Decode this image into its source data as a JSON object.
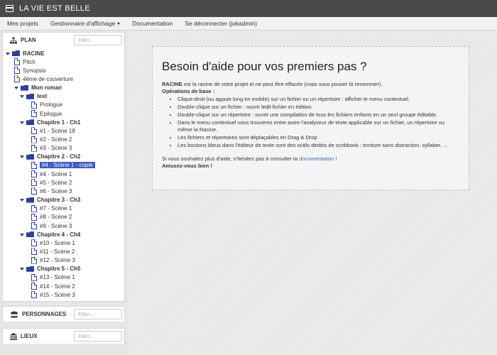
{
  "app": {
    "title": "LA VIE EST BELLE"
  },
  "menu": {
    "projects": "Mes projets",
    "display_manager": "Gestionnaire d'affichage",
    "documentation": "Documentation",
    "logout": "Se déconnecter (jokadmin)"
  },
  "panels": {
    "plan": {
      "label": "PLAN",
      "filter_placeholder": "Filter..."
    },
    "characters": {
      "label": "PERSONNAGES",
      "filter_placeholder": "Filter..."
    },
    "places": {
      "label": "LIEUX",
      "filter_placeholder": "Filter..."
    }
  },
  "tree": [
    {
      "label": "RACINE",
      "kind": "folder",
      "level": 0,
      "bold": true
    },
    {
      "label": "Pitch",
      "kind": "file",
      "level": 1
    },
    {
      "label": "Synopsis",
      "kind": "file",
      "level": 1
    },
    {
      "label": "4ème de couverture",
      "kind": "file",
      "level": 1
    },
    {
      "label": "Mon roman",
      "kind": "folder",
      "level": 1,
      "bold": true
    },
    {
      "label": "test",
      "kind": "folder",
      "level": 2,
      "bold": true
    },
    {
      "label": "Prologue",
      "kind": "file",
      "level": 3
    },
    {
      "label": "Epilogue",
      "kind": "file",
      "level": 3
    },
    {
      "label": "Chapitre 1 - Ch1",
      "kind": "folder",
      "level": 2,
      "bold": true
    },
    {
      "label": "#1 - Scène 18",
      "kind": "file",
      "level": 3
    },
    {
      "label": "#2 - Scène 2",
      "kind": "file",
      "level": 3
    },
    {
      "label": "#3 - Scène 3",
      "kind": "file",
      "level": 3
    },
    {
      "label": "Chapitre 2 - Ch2",
      "kind": "folder",
      "level": 2,
      "bold": true
    },
    {
      "label": "#4 - Scène 1 - copie",
      "kind": "file",
      "level": 3,
      "selected": true
    },
    {
      "label": "#4 - Scène 1",
      "kind": "file",
      "level": 3
    },
    {
      "label": "#5 - Scène 2",
      "kind": "file",
      "level": 3
    },
    {
      "label": "#6 - Scène 3",
      "kind": "file",
      "level": 3
    },
    {
      "label": "Chapitre 3 - Ch3",
      "kind": "folder",
      "level": 2,
      "bold": true
    },
    {
      "label": "#7 - Scène 1",
      "kind": "file",
      "level": 3
    },
    {
      "label": "#8 - Scène 2",
      "kind": "file",
      "level": 3
    },
    {
      "label": "#9 - Scène 3",
      "kind": "file",
      "level": 3
    },
    {
      "label": "Chapitre 4 - Ch4",
      "kind": "folder",
      "level": 2,
      "bold": true
    },
    {
      "label": "#10 - Scène 1",
      "kind": "file",
      "level": 3
    },
    {
      "label": "#11 - Scène 2",
      "kind": "file",
      "level": 3
    },
    {
      "label": "#12 - Scène 3",
      "kind": "file",
      "level": 3
    },
    {
      "label": "Chapitre 5 - Ch5",
      "kind": "folder",
      "level": 2,
      "bold": true
    },
    {
      "label": "#13 - Scène 1",
      "kind": "file",
      "level": 3
    },
    {
      "label": "#14 - Scène 2",
      "kind": "file",
      "level": 3
    },
    {
      "label": "#15 - Scène 3",
      "kind": "file",
      "level": 3
    }
  ],
  "help": {
    "title": "Besoin d'aide pour vos premiers pas ?",
    "intro_strong": "RACINE",
    "intro_rest": " est la racine de votre projet et ne peut être effacée (mais vous pouver la renommer).",
    "ops_title": "Opérations de base :",
    "bullets": [
      "Clique-droit (ou appuie long en mobile) sur un fichier ou un répertoire : afficher le menu contextuel.",
      "Double-clique sur un fichier : ouvrir ledit fichier en édition.",
      "Double-clique sur un répertoire : ouvrir une compilation de tous les fichiers enfants en un seul groupe éditable.",
      "Dans le menu contextuel vous trouverez entre autre l'analyseur de texte applicable sur un fichier, un répertoire ou même la Racine.",
      "Les fichiers et répertoires sont déplaçables en Drag & Drop",
      "Les boutons bleus dans l'éditeur de texte sont des outils dédiés de scribbook : écriture sans distraction, syllaber, ..."
    ],
    "footer_before": "Si vous souhaitez plus d'aide, n'hésitez pas à consulter la ",
    "footer_link": "documentation",
    "footer_after": " !",
    "closing": "Amusez-vous bien !"
  }
}
